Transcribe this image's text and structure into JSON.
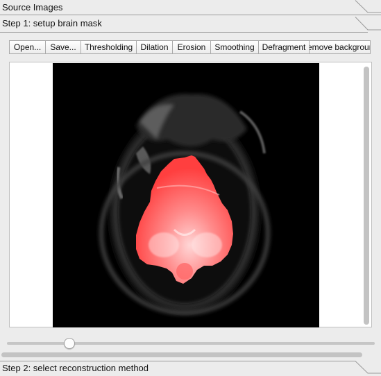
{
  "sections": {
    "source_images": "Source Images",
    "step1": "Step 1: setup brain mask",
    "step2": "Step 2: select reconstruction method"
  },
  "toolbar": {
    "open": "Open...",
    "save": "Save...",
    "thresholding": "Thresholding",
    "dilation": "Dilation",
    "erosion": "Erosion",
    "smoothing": "Smoothing",
    "defragment": "Defragment",
    "remove_background": "emove backgroun"
  },
  "viewer": {
    "mask_color": "#ff4a4a"
  },
  "slider": {
    "position_fraction": 0.16
  }
}
